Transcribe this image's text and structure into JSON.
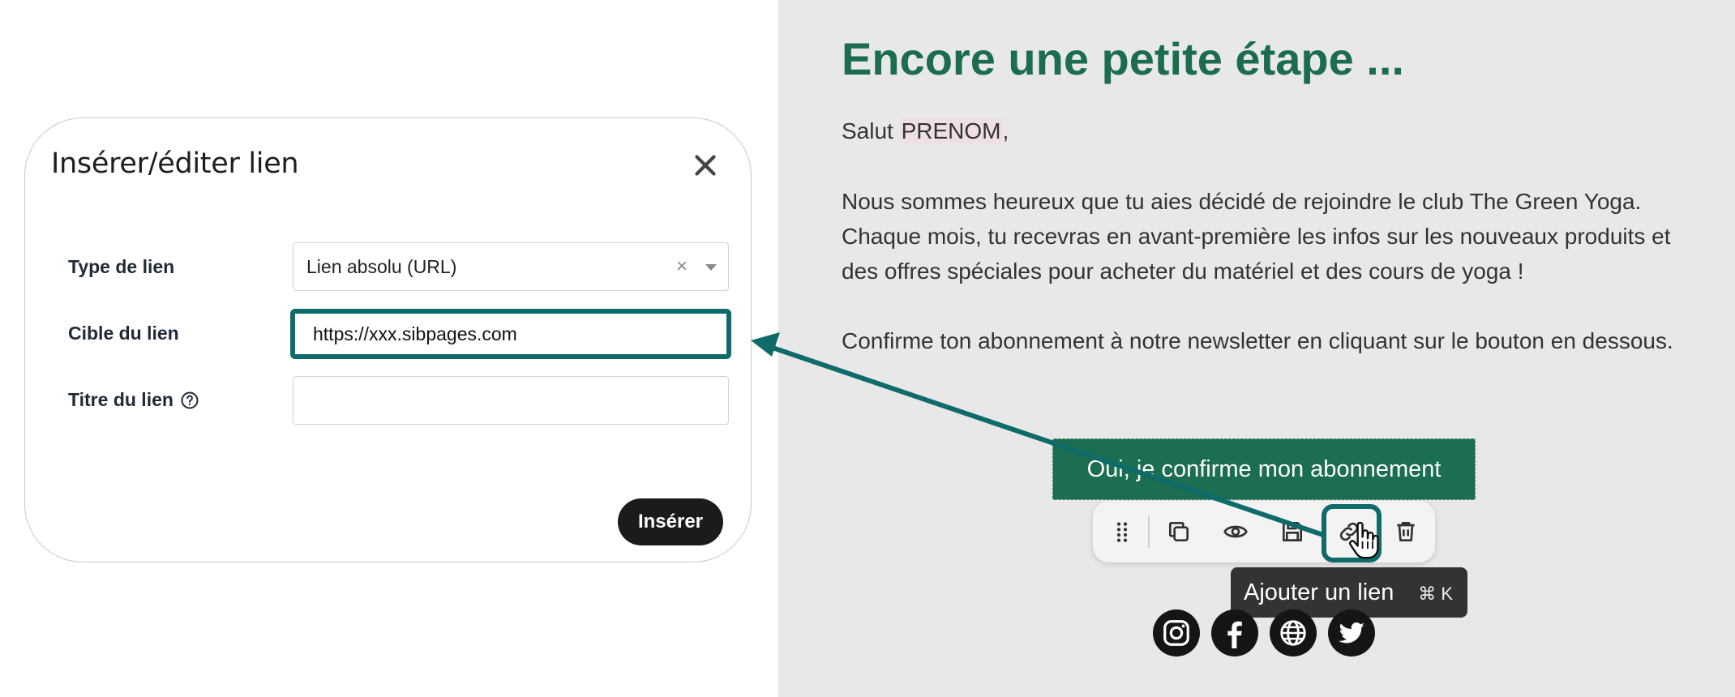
{
  "dialog": {
    "title": "Insérer/éditer lien",
    "close_icon": "close-icon",
    "fields": {
      "type_label": "Type de lien",
      "type_value": "Lien absolu (URL)",
      "target_label": "Cible du lien",
      "target_value": "https://xxx.sibpages.com",
      "title_label": "Titre du lien",
      "title_value": ""
    },
    "insert_label": "Insérer"
  },
  "email": {
    "heading": "Encore une petite étape ...",
    "greeting_prefix": "Salut ",
    "greeting_name": "PRENOM",
    "greeting_suffix": ",",
    "paragraph1": "Nous sommes heureux que tu aies décidé de rejoindre le club The Green Yoga. Chaque mois, tu recevras en avant-première les infos sur les nouveaux produits et des offres spéciales pour acheter du matériel et des cours de yoga !",
    "paragraph2": "Confirme ton abonnement à notre newsletter en cliquant sur le bouton en dessous.",
    "cta_label": "Oui, je confirme mon abonnement"
  },
  "toolbar": {
    "icons": [
      "drag-handle-icon",
      "duplicate-icon",
      "eye-icon",
      "save-icon",
      "link-icon",
      "trash-icon"
    ],
    "tooltip_label": "Ajouter un lien",
    "tooltip_shortcut": "⌘ K"
  },
  "socials": [
    "instagram-icon",
    "facebook-icon",
    "globe-icon",
    "twitter-icon"
  ],
  "colors": {
    "accent_teal": "#0e6b69",
    "brand_green": "#1c6d4e",
    "cta_green": "#1b6e4f",
    "editor_bg": "#e8e8e8"
  }
}
